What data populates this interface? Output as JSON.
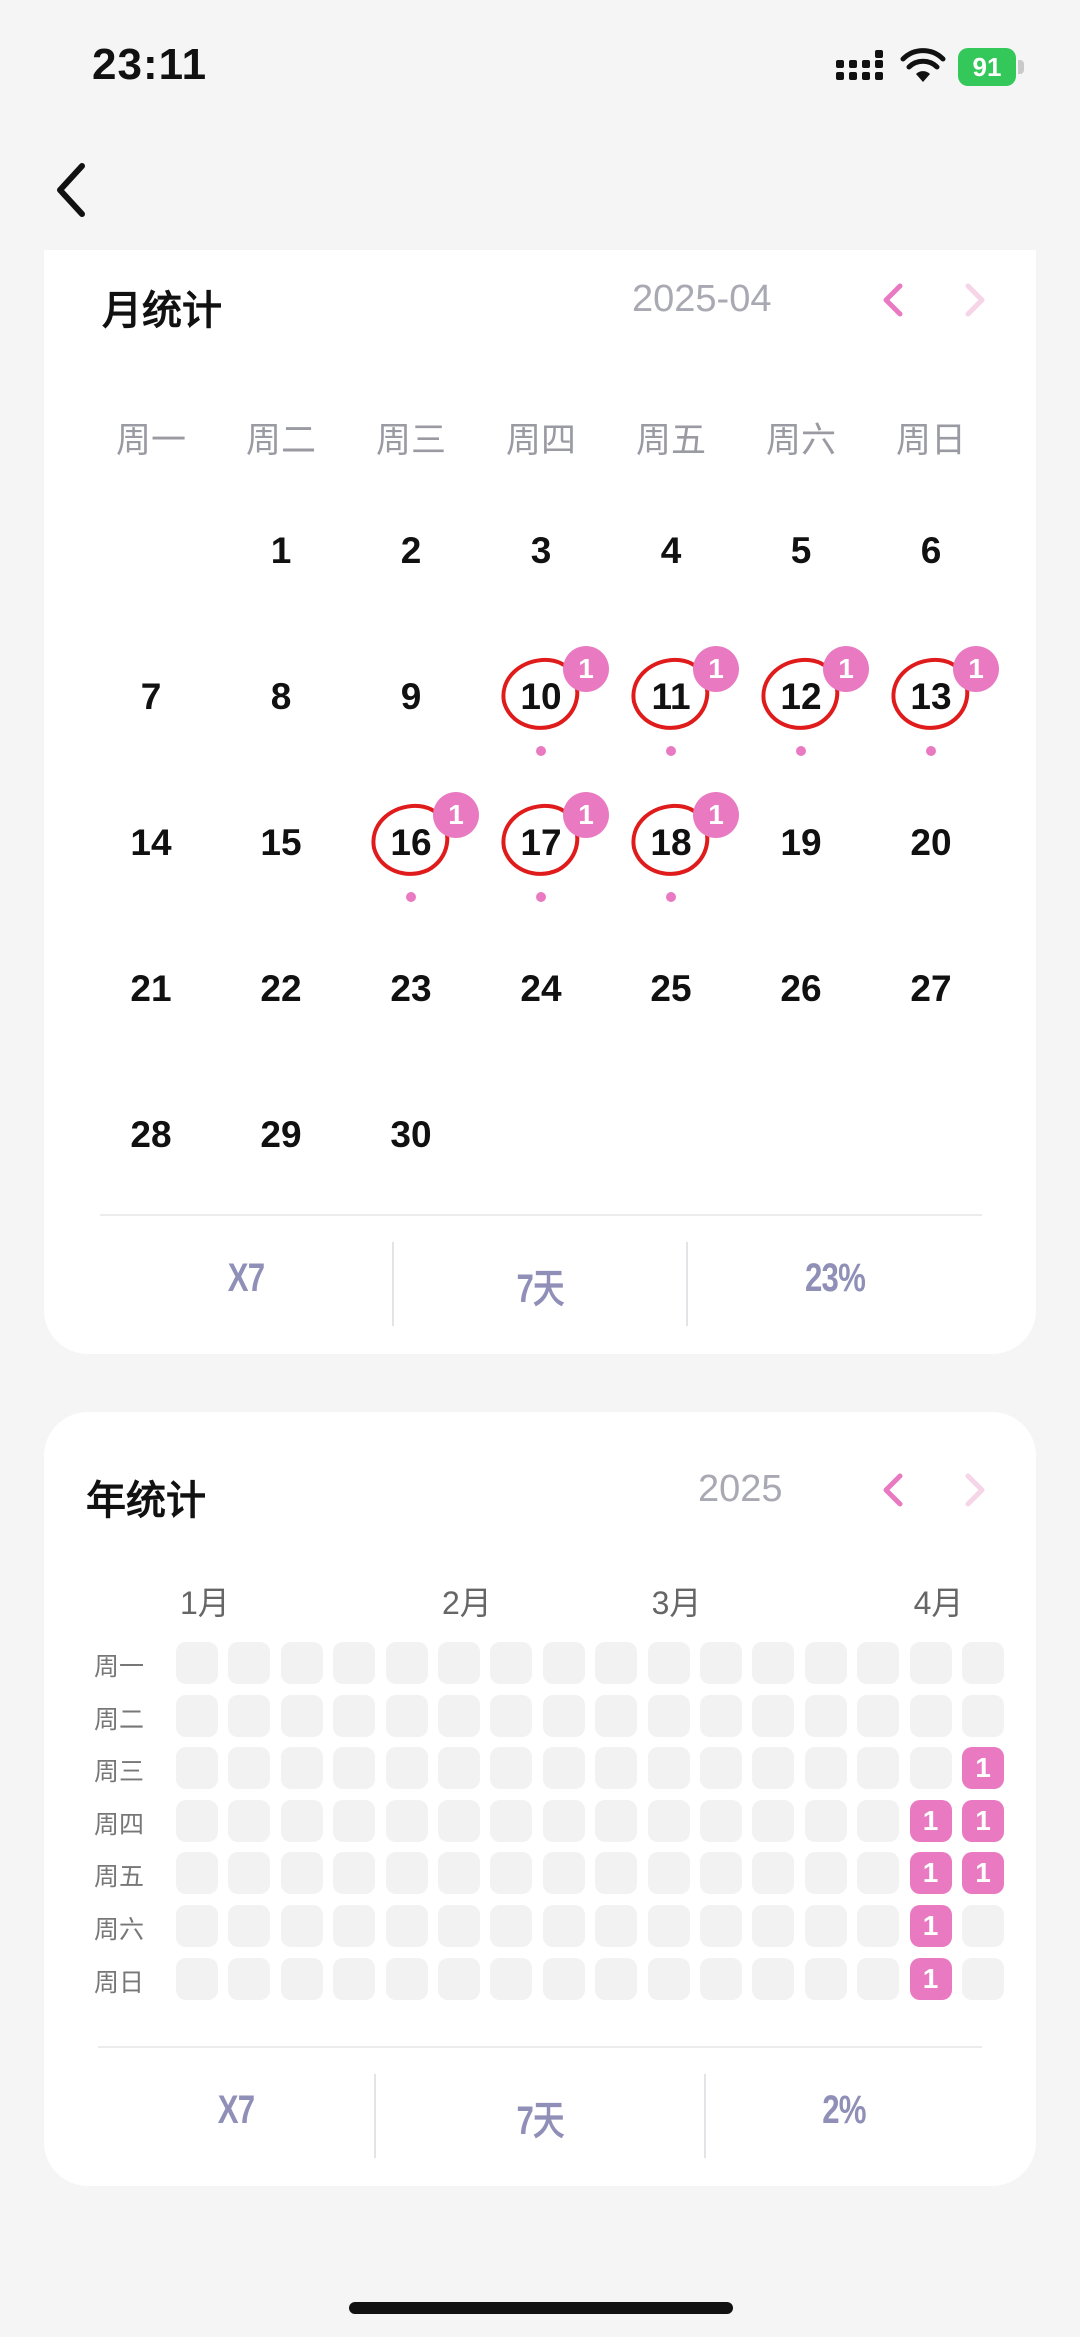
{
  "status_bar": {
    "time": "23:11",
    "battery": "91"
  },
  "colors": {
    "accent": "#e97ac2",
    "ring": "#e01b1b",
    "stat": "#8f8fb8",
    "muted": "#a9a9b3"
  },
  "icons": {
    "back": "chevron-left-icon",
    "prev": "chevron-left-icon",
    "next": "chevron-right-icon"
  },
  "month_stats": {
    "title": "月统计",
    "period": "2025-04",
    "weekdays": [
      "周一",
      "周二",
      "周三",
      "周四",
      "周五",
      "周六",
      "周日"
    ],
    "first_weekday_index": 1,
    "days_in_month": 30,
    "checked_days": [
      {
        "day": 10,
        "count": "1"
      },
      {
        "day": 11,
        "count": "1"
      },
      {
        "day": 12,
        "count": "1"
      },
      {
        "day": 13,
        "count": "1"
      },
      {
        "day": 16,
        "count": "1"
      },
      {
        "day": 17,
        "count": "1"
      },
      {
        "day": 18,
        "count": "1"
      }
    ],
    "summary": [
      "X7",
      "7天",
      "23%"
    ]
  },
  "year_stats": {
    "title": "年统计",
    "period": "2025",
    "month_labels": [
      "1月",
      "2月",
      "3月",
      "4月"
    ],
    "month_label_columns": [
      0,
      5,
      9,
      14
    ],
    "weekdays": [
      "周一",
      "周二",
      "周三",
      "周四",
      "周五",
      "周六",
      "周日"
    ],
    "visible_columns": 16,
    "active_cells": [
      {
        "col": 15,
        "row": 2,
        "count": "1"
      },
      {
        "col": 14,
        "row": 3,
        "count": "1"
      },
      {
        "col": 15,
        "row": 3,
        "count": "1"
      },
      {
        "col": 14,
        "row": 4,
        "count": "1"
      },
      {
        "col": 15,
        "row": 4,
        "count": "1"
      },
      {
        "col": 14,
        "row": 5,
        "count": "1"
      },
      {
        "col": 14,
        "row": 6,
        "count": "1"
      }
    ],
    "summary": [
      "X7",
      "7天",
      "2%"
    ]
  }
}
